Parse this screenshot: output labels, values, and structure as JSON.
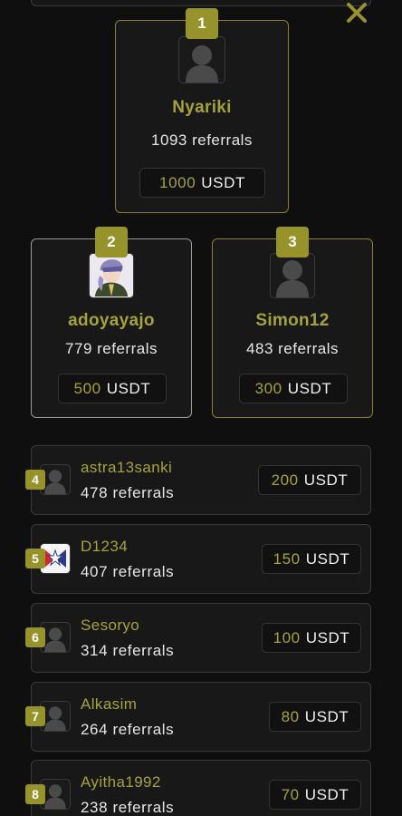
{
  "close_icon": "close-icon",
  "podium": [
    {
      "rank": "1",
      "name": "Nyariki",
      "referrals": "1093 referrals",
      "amount": "1000",
      "currency": "USDT",
      "avatar": "default-user-icon"
    },
    {
      "rank": "2",
      "name": "adoyayajo",
      "referrals": "779 referrals",
      "amount": "500",
      "currency": "USDT",
      "avatar": "photo-avatar"
    },
    {
      "rank": "3",
      "name": "Simon12",
      "referrals": "483 referrals",
      "amount": "300",
      "currency": "USDT",
      "avatar": "default-user-icon"
    }
  ],
  "list": [
    {
      "rank": "4",
      "name": "astra13sanki",
      "referrals": "478 referrals",
      "amount": "200",
      "currency": "USDT"
    },
    {
      "rank": "5",
      "name": "D1234",
      "referrals": "407 referrals",
      "amount": "150",
      "currency": "USDT"
    },
    {
      "rank": "6",
      "name": "Sesoryo",
      "referrals": "314 referrals",
      "amount": "100",
      "currency": "USDT"
    },
    {
      "rank": "7",
      "name": "Alkasim",
      "referrals": "264 referrals",
      "amount": "80",
      "currency": "USDT"
    },
    {
      "rank": "8",
      "name": "Ayitha1992",
      "referrals": "238 referrals",
      "amount": "70",
      "currency": "USDT"
    }
  ],
  "colors": {
    "accent": "#96932a",
    "name": "#a6a23a",
    "background": "#0f0f0f"
  }
}
